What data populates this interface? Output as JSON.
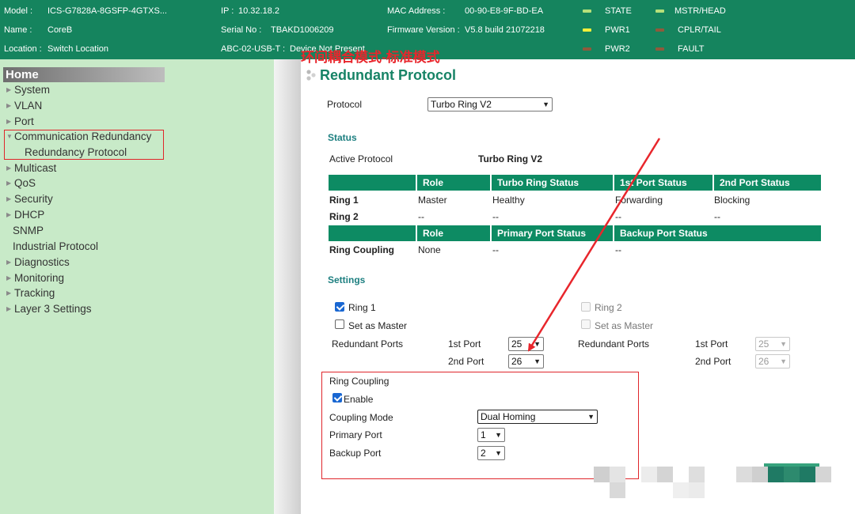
{
  "banner": {
    "model_label": "Model :",
    "model_value": "ICS-G7828A-8GSFP-4GTXS...",
    "name_label": "Name :",
    "name_value": "CoreB",
    "location_label": "Location :",
    "location_value": "Switch Location",
    "ip_label": "IP :",
    "ip_value": "10.32.18.2",
    "serial_label": "Serial No :",
    "serial_value": "TBAKD1006209",
    "abc_label": "ABC-02-USB-T :",
    "abc_value": "Device Not Present",
    "mac_label": "MAC Address :",
    "mac_value": "00-90-E8-9F-BD-EA",
    "firmware_label": "Firmware Version :",
    "firmware_value": "V5.8 build 21072218",
    "leds": [
      {
        "label": "STATE",
        "color": "#b6e07a"
      },
      {
        "label": "MSTR/HEAD",
        "color": "#b6e07a"
      },
      {
        "label": "PWR1",
        "color": "#f2ef3a"
      },
      {
        "label": "CPLR/TAIL",
        "color": "#8e5a3c"
      },
      {
        "label": "PWR2",
        "color": "#8e5a3c"
      },
      {
        "label": "FAULT",
        "color": "#8e5a3c"
      }
    ]
  },
  "sidebar": {
    "home": "Home",
    "items": [
      {
        "label": "System"
      },
      {
        "label": "VLAN"
      },
      {
        "label": "Port"
      },
      {
        "label": "Communication Redundancy"
      },
      {
        "label": "Redundancy Protocol"
      },
      {
        "label": "Multicast"
      },
      {
        "label": "QoS"
      },
      {
        "label": "Security"
      },
      {
        "label": "DHCP"
      },
      {
        "label": "SNMP"
      },
      {
        "label": "Industrial Protocol"
      },
      {
        "label": "Diagnostics"
      },
      {
        "label": "Monitoring"
      },
      {
        "label": "Tracking"
      },
      {
        "label": "Layer 3 Settings"
      }
    ]
  },
  "main": {
    "title": "Redundant Protocol",
    "protocol_label": "Protocol",
    "protocol_value": "Turbo Ring V2",
    "status_heading": "Status",
    "active_protocol_label": "Active Protocol",
    "active_protocol_value": "Turbo Ring V2",
    "ring_table": {
      "headers": [
        "Role",
        "Turbo Ring Status",
        "1st Port Status",
        "2nd Port Status"
      ],
      "rows": [
        {
          "label": "Ring 1",
          "cells": [
            "Master",
            "Healthy",
            "Forwarding",
            "Blocking"
          ]
        },
        {
          "label": "Ring 2",
          "cells": [
            "--",
            "--",
            "--",
            "--"
          ]
        }
      ]
    },
    "coupling_table": {
      "headers": [
        "Role",
        "Primary Port Status",
        "Backup Port Status"
      ],
      "row": {
        "label": "Ring Coupling",
        "cells": [
          "None",
          "--",
          "--"
        ]
      }
    },
    "settings_heading": "Settings",
    "ring1": {
      "label": "Ring 1",
      "set_master": "Set as Master",
      "redundant_ports": "Redundant Ports",
      "first_port_label": "1st Port",
      "first_port": "25",
      "second_port_label": "2nd Port",
      "second_port": "26"
    },
    "ring2": {
      "label": "Ring 2",
      "set_master": "Set as Master",
      "redundant_ports": "Redundant Ports",
      "first_port_label": "1st Port",
      "first_port": "25",
      "second_port_label": "2nd Port",
      "second_port": "26"
    },
    "coupling": {
      "heading": "Ring Coupling",
      "enable_label": "Enable",
      "mode_label": "Coupling Mode",
      "mode_value": "Dual Homing",
      "primary_label": "Primary Port",
      "primary_value": "1",
      "backup_label": "Backup Port",
      "backup_value": "2"
    },
    "annotation": "环间耦合模式-标准模式"
  },
  "colors": {
    "banner": "#15845e",
    "sidebar": "#c8eac8",
    "accent": "#0d8b63",
    "highlight": "#e0262b"
  }
}
